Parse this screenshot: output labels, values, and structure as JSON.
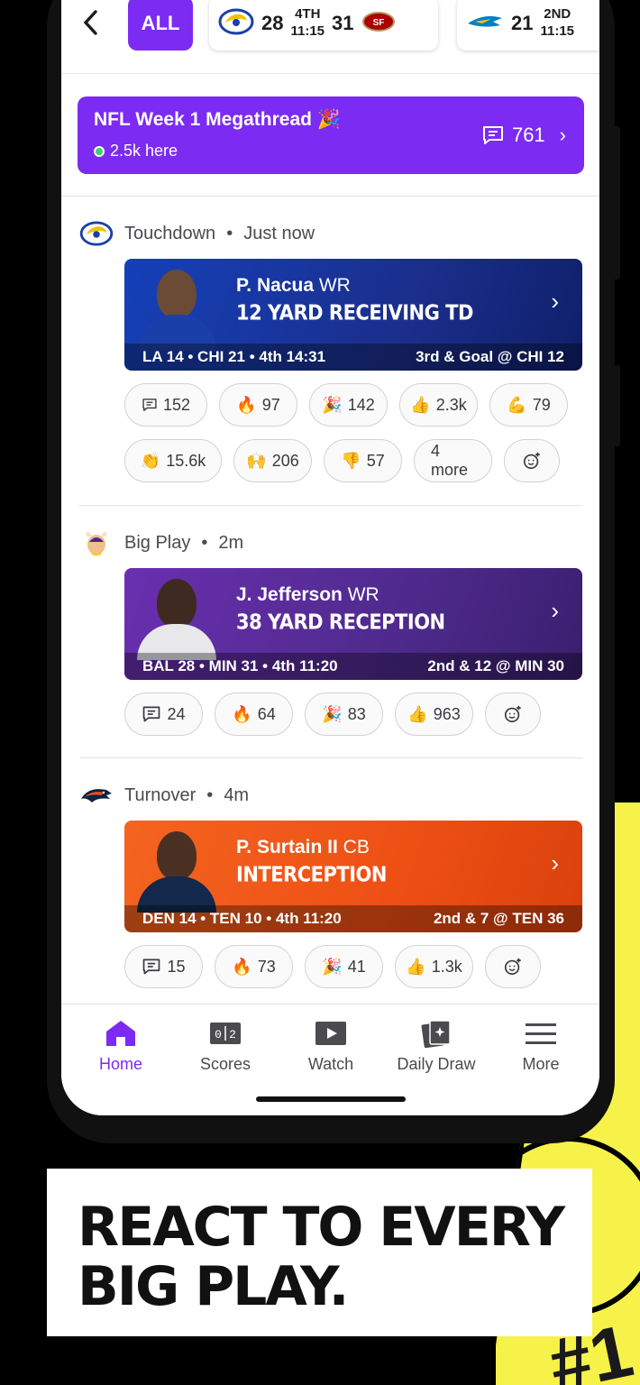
{
  "scorebar": {
    "all_label": "ALL",
    "games": [
      {
        "away_score": "28",
        "quarter": "4TH",
        "clock": "11:15",
        "home_score": "31"
      },
      {
        "away_score": "21",
        "quarter": "2ND",
        "clock": "11:15"
      }
    ]
  },
  "megathread": {
    "title": "NFL Week 1 Megathread 🎉",
    "here": "2.5k here",
    "comments": "761"
  },
  "feed": [
    {
      "type": "Touchdown",
      "time": "Just now",
      "player": "P. Nacua",
      "position": "WR",
      "description": "12 YARD RECEIVING TD",
      "score_line": "LA 14 • CHI 21 • 4th 14:31",
      "situation": "3rd & Goal @ CHI 12",
      "reactions": [
        {
          "icon": "comment-icon",
          "count": "152"
        },
        {
          "icon": "🔥",
          "count": "97"
        },
        {
          "icon": "🎉",
          "count": "142"
        },
        {
          "icon": "👍",
          "count": "2.3k"
        },
        {
          "icon": "💪",
          "count": "79"
        },
        {
          "icon": "👏",
          "count": "15.6k"
        },
        {
          "icon": "🙌",
          "count": "206"
        },
        {
          "icon": "👎",
          "count": "57"
        }
      ],
      "more": "4 more"
    },
    {
      "type": "Big Play",
      "time": "2m",
      "player": "J. Jefferson",
      "position": "WR",
      "description": "38 YARD RECEPTION",
      "score_line": "BAL 28 • MIN 31 • 4th 11:20",
      "situation": "2nd & 12 @ MIN 30",
      "reactions": [
        {
          "icon": "comment-icon",
          "count": "24"
        },
        {
          "icon": "🔥",
          "count": "64"
        },
        {
          "icon": "🎉",
          "count": "83"
        },
        {
          "icon": "👍",
          "count": "963"
        }
      ]
    },
    {
      "type": "Turnover",
      "time": "4m",
      "player": "P. Surtain II",
      "position": "CB",
      "description": "INTERCEPTION",
      "score_line": "DEN 14 • TEN 10 • 4th 11:20",
      "situation": "2nd & 7 @ TEN 36",
      "reactions": [
        {
          "icon": "comment-icon",
          "count": "15"
        },
        {
          "icon": "🔥",
          "count": "73"
        },
        {
          "icon": "🎉",
          "count": "41"
        },
        {
          "icon": "👍",
          "count": "1.3k"
        }
      ]
    }
  ],
  "nav": {
    "home": "Home",
    "scores": "Scores",
    "watch": "Watch",
    "daily_draw": "Daily Draw",
    "more": "More",
    "active_color": "#7c2bf2"
  },
  "caption": {
    "line1": "REACT TO EVERY",
    "line2": "BIG PLAY."
  },
  "colors": {
    "accent": "#7c2bf2",
    "rams_card": "#1b3fa8",
    "vikings_card": "#5b2a93",
    "broncos_card": "#f0541e",
    "background_yellow": "#f6f24a"
  }
}
